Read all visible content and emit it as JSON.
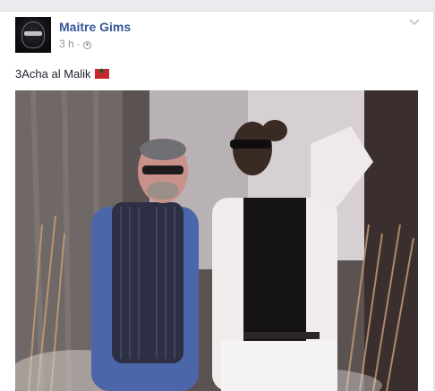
{
  "post": {
    "author": "Maitre Gims",
    "time": "3 h",
    "separator": "·",
    "privacy_icon": "globe-icon",
    "options_icon": "chevron-down-icon",
    "text": "3Acha al Malik",
    "emoji": "morocco-flag-icon"
  },
  "colors": {
    "author_link": "#365899",
    "meta_text": "#90949c",
    "body_text": "#1d2129",
    "background": "#e9ebee"
  }
}
